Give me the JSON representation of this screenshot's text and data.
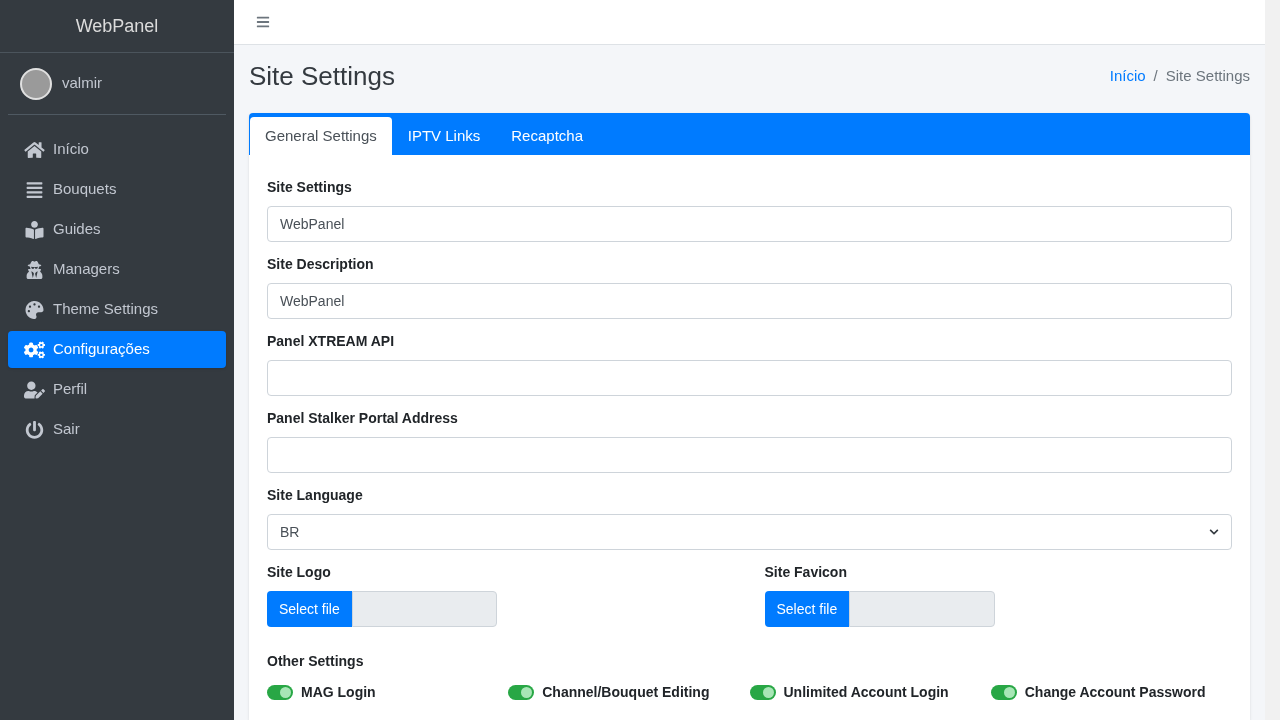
{
  "sidebar": {
    "brand": "WebPanel",
    "user": "valmir",
    "items": [
      {
        "label": "Início",
        "selected": false
      },
      {
        "label": "Bouquets",
        "selected": false
      },
      {
        "label": "Guides",
        "selected": false
      },
      {
        "label": "Managers",
        "selected": false
      },
      {
        "label": "Theme Settings",
        "selected": false
      },
      {
        "label": "Configurações",
        "selected": true
      },
      {
        "label": "Perfil",
        "selected": false
      },
      {
        "label": "Sair",
        "selected": false
      }
    ]
  },
  "page": {
    "title": "Site Settings",
    "breadcrumb": [
      {
        "label": "Início",
        "link": true
      },
      {
        "label": "Site Settings",
        "link": false
      }
    ],
    "breadcrumb_separator": "/"
  },
  "tabs": [
    {
      "label": "General Settings",
      "selected": true
    },
    {
      "label": "IPTV Links",
      "selected": false
    },
    {
      "label": "Recaptcha",
      "selected": false
    }
  ],
  "fields": [
    {
      "label": "Site Settings",
      "kind": "text",
      "value": "WebPanel"
    },
    {
      "label": "Site Description",
      "kind": "text",
      "value": "WebPanel"
    },
    {
      "label": "Panel XTREAM API",
      "kind": "text"
    },
    {
      "label": "Panel Stalker Portal Address",
      "kind": "text"
    },
    {
      "label": "Site Language",
      "kind": "select",
      "value": "BR"
    }
  ],
  "uploads": [
    {
      "label": "Site Logo",
      "button": "Select file"
    },
    {
      "label": "Site Favicon",
      "button": "Select file"
    }
  ],
  "other_settings": {
    "label": "Other Settings",
    "toggles": [
      {
        "label": "MAG Login",
        "on": true
      },
      {
        "label": "Channel/Bouquet Editing",
        "on": true
      },
      {
        "label": "Unlimited Account Login",
        "on": true
      },
      {
        "label": "Change Account Password",
        "on": true
      }
    ]
  }
}
